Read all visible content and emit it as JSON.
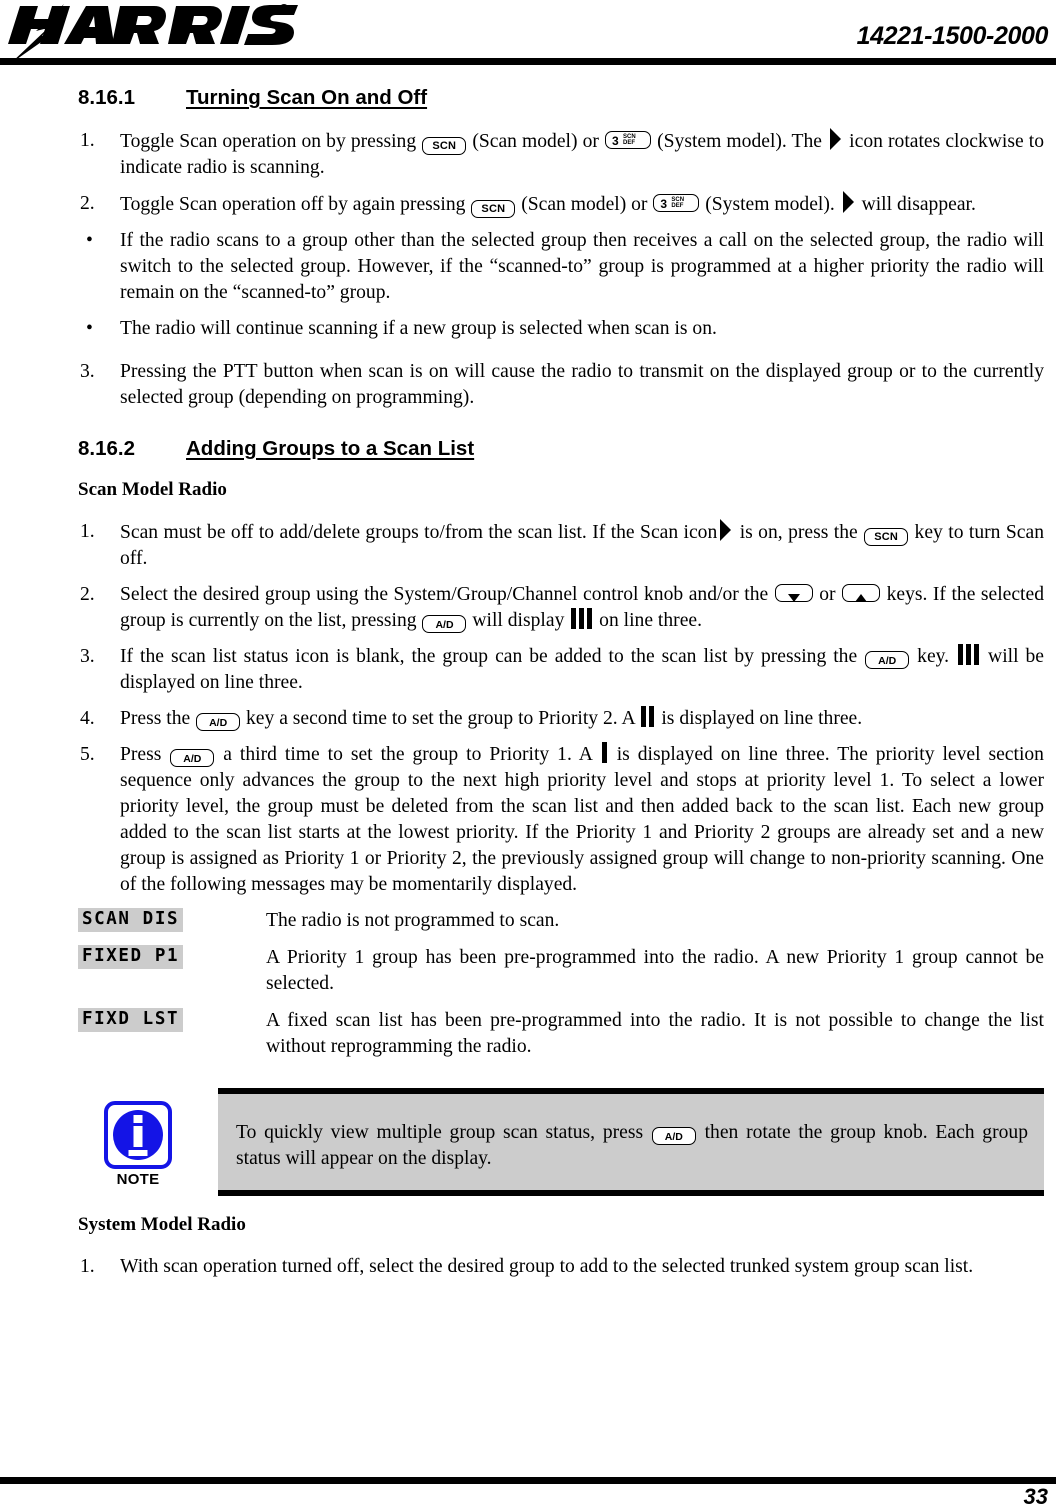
{
  "header": {
    "logo_text": "HARRIS",
    "logo_trademark": "®",
    "doc_number": "14221-1500-2000"
  },
  "footer": {
    "page_number": "33"
  },
  "sections": [
    {
      "number": "8.16.1",
      "title": "Turning Scan On and Off"
    },
    {
      "number": "8.16.2",
      "title": "Adding Groups to a Scan List"
    }
  ],
  "section1": {
    "item1": {
      "marker": "1.",
      "text_a": "Toggle Scan operation on by pressing ",
      "text_b": " (Scan model) or ",
      "text_c": " (System model). The ",
      "text_d": " icon rotates clockwise to indicate radio is scanning."
    },
    "item2": {
      "marker": "2.",
      "text_a": "Toggle Scan operation off by again pressing ",
      "text_b": " (Scan model) or ",
      "text_c": " (System model). ",
      "text_d": " will disappear."
    },
    "bullets": [
      "If the radio scans to a group other than the selected group then receives a call on the selected group, the radio will switch to the selected group. However, if the “scanned-to” group is programmed at a higher priority the radio will remain on the “scanned-to” group.",
      "The radio will continue scanning if a new group is selected when scan is on."
    ],
    "item3": {
      "marker": "3.",
      "text": "Pressing the PTT button when scan is on will cause the radio to transmit on the displayed group or to the currently selected group (depending on programming)."
    }
  },
  "section2": {
    "scan_model_heading": "Scan Model Radio",
    "system_model_heading": "System Model Radio",
    "item1": {
      "marker": "1.",
      "text_a": "Scan must be off to add/delete groups to/from the scan list. If the Scan icon",
      "text_b": " is on, press the ",
      "text_c": " key to turn Scan off."
    },
    "item2": {
      "marker": "2.",
      "text_a": "Select the desired group using the System/Group/Channel control knob and/or the ",
      "text_b": " or ",
      "text_c": " keys. If the selected group is currently on the list, pressing ",
      "text_d": " will display ",
      "text_e": " on line three."
    },
    "item3": {
      "marker": "3.",
      "text_a": "If the scan list status icon is blank, the group can be added to the scan list by pressing the ",
      "text_b": " key. ",
      "text_c": " will be displayed on line three."
    },
    "item4": {
      "marker": "4.",
      "text_a": "Press the ",
      "text_b": " key a second time to set the group to Priority 2. A ",
      "text_c": " is displayed on line three."
    },
    "item5": {
      "marker": "5.",
      "text_a": "Press ",
      "text_b": " a third time to set the group to Priority 1. A ",
      "text_c": " is displayed on line three. The priority level section sequence only advances the group to the next high priority level and stops at priority level 1. To select a lower priority level, the group must be deleted from the scan list and then added back to the scan list. Each new group added to the scan list starts at the lowest priority. If the Priority 1 and Priority 2 groups are already set and a new group is assigned as Priority 1 or Priority 2, the previously assigned group will change to non-priority scanning. One of the following messages may be momentarily displayed."
    },
    "messages": [
      {
        "display": "SCAN DIS",
        "description": "The radio is not programmed to scan."
      },
      {
        "display": "FIXED P1",
        "description": "A Priority 1 group has been pre-programmed into the radio. A new Priority 1 group cannot be selected."
      },
      {
        "display": "FIXD LST",
        "description": "A fixed scan list has been pre-programmed into the radio. It is not possible to change the list without reprogramming the radio."
      }
    ],
    "system_item1": {
      "marker": "1.",
      "text": "With scan operation turned off, select the desired group to add to the selected trunked system group scan list."
    }
  },
  "note": {
    "label": "NOTE",
    "text_a": "To quickly view multiple group scan status, press ",
    "text_b": " then rotate the group knob. Each group status will appear on the display."
  },
  "keys": {
    "scn_label": "SCN",
    "ad_label": "A/D",
    "sys_digit": "3",
    "sys_line1": "SCN",
    "sys_line2": "DEF"
  },
  "colors": {
    "note_blue": "#1414e6",
    "note_panel_gray": "#cccccc",
    "lcd_gray": "#cccccc",
    "rule_black": "#000000"
  }
}
